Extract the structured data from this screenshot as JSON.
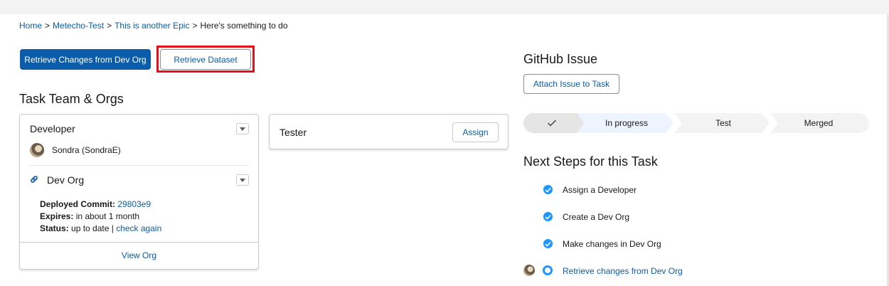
{
  "breadcrumb": {
    "home": "Home",
    "project": "Metecho-Test",
    "epic": "This is another Epic",
    "current": "Here's something to do",
    "separator": ">"
  },
  "actions": {
    "retrieve_changes": "Retrieve Changes from Dev Org",
    "retrieve_dataset": "Retrieve Dataset"
  },
  "team": {
    "heading": "Task Team & Orgs",
    "developer": {
      "title": "Developer",
      "user": "Sondra (SondraE)",
      "org_title": "Dev Org",
      "commit_label": "Deployed Commit:",
      "commit_value": "29803e9",
      "expires_label": "Expires:",
      "expires_value": "in about 1 month",
      "status_label": "Status:",
      "status_value": "up to date |",
      "status_link": "check again",
      "view_org": "View Org"
    },
    "tester": {
      "title": "Tester",
      "assign": "Assign"
    }
  },
  "github": {
    "heading": "GitHub Issue",
    "attach": "Attach Issue to Task"
  },
  "progress": {
    "steps": [
      "✓",
      "In progress",
      "Test",
      "Merged"
    ],
    "current": "In progress"
  },
  "next_steps": {
    "heading": "Next Steps for this Task",
    "items": [
      {
        "label": "Assign a Developer",
        "status": "complete"
      },
      {
        "label": "Create a Dev Org",
        "status": "complete"
      },
      {
        "label": "Make changes in Dev Org",
        "status": "complete"
      },
      {
        "label": "Retrieve changes from Dev Org",
        "status": "active"
      }
    ]
  },
  "colors": {
    "brand": "#0b5cab",
    "highlight": "#e4101a",
    "step_complete": "#1b96ff",
    "path_current": "#eef4ff",
    "path_incomplete": "#f3f3f3"
  }
}
